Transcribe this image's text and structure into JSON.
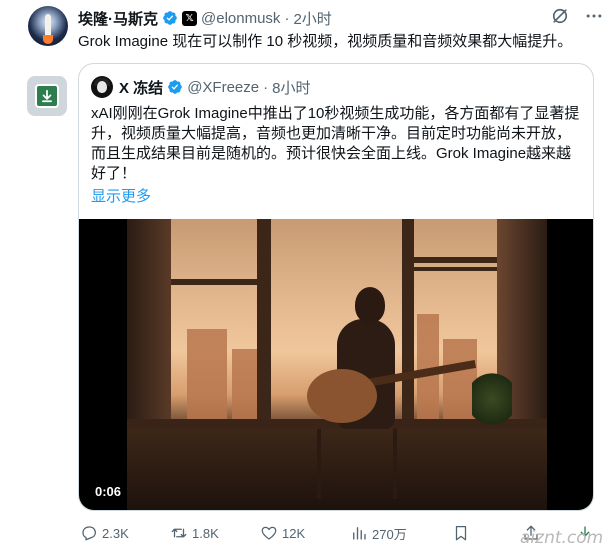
{
  "post": {
    "author_name": "埃隆·马斯克",
    "handle": "@elonmusk",
    "separator": "·",
    "time": "2小时",
    "text": "Grok Imagine 现在可以制作 10 秒视频，视频质量和音频效果都大幅提升。"
  },
  "quote": {
    "author_name": "X 冻结",
    "handle": "@XFreeze",
    "separator": "·",
    "time": "8小时",
    "text_lines": [
      "xAI刚刚在Grok Imagine中推出了10秒视频生成功能，各方面都有了显著提",
      "升，视频质量大幅提高，音频也更加清晰干净。目前定时功能尚未开放，",
      "而且生成结果目前是随机的。预计很快会全面上线。Grok Imagine越来越",
      "好了！"
    ],
    "show_more": "显示更多",
    "video_duration": "0:06"
  },
  "actions": {
    "reply_count": "2.3K",
    "retweet_count": "1.8K",
    "like_count": "12K",
    "view_count": "270万"
  },
  "watermark": "aiznt.com",
  "colors": {
    "verified": "#1d9bf0",
    "link": "#1d9bf0",
    "muted": "#536471",
    "border": "#cfd9de"
  },
  "icons": [
    "grok-icon",
    "more-icon",
    "verified-icon",
    "x-affiliate-icon",
    "download-app-icon",
    "reply-icon",
    "retweet-icon",
    "like-icon",
    "views-icon",
    "bookmark-icon",
    "share-icon",
    "download-icon"
  ]
}
